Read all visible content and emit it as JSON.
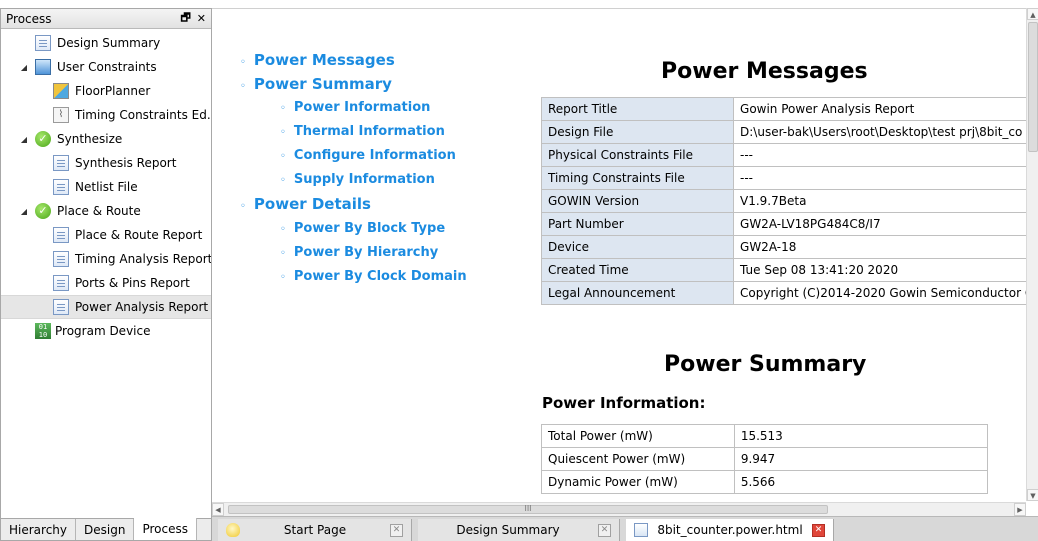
{
  "panel": {
    "title": "Process",
    "float_glyph": "🗗",
    "close_glyph": "✕",
    "tree": [
      {
        "label": "Design Summary",
        "icon": "document-icon"
      },
      {
        "label": "User Constraints",
        "icon": "user-constraints-icon",
        "expander": "◢"
      },
      {
        "label": "FloorPlanner",
        "icon": "floorplanner-icon"
      },
      {
        "label": "Timing Constraints Ed...",
        "icon": "timing-constraints-icon"
      },
      {
        "label": "Synthesize",
        "icon": "check-icon",
        "expander": "◢"
      },
      {
        "label": "Synthesis Report",
        "icon": "document-icon"
      },
      {
        "label": "Netlist File",
        "icon": "document-icon"
      },
      {
        "label": "Place & Route",
        "icon": "check-icon",
        "expander": "◢"
      },
      {
        "label": "Place & Route Report",
        "icon": "document-icon"
      },
      {
        "label": "Timing Analysis Report",
        "icon": "document-icon"
      },
      {
        "label": "Ports & Pins Report",
        "icon": "document-icon"
      },
      {
        "label": "Power Analysis Report",
        "icon": "document-icon",
        "selected": true
      },
      {
        "label": "Program Device",
        "icon": "program-device-icon"
      }
    ],
    "bottom_tabs": [
      "Hierarchy",
      "Design",
      "Process"
    ]
  },
  "toc": {
    "items": [
      {
        "label": "Power Messages",
        "level": 1
      },
      {
        "label": "Power Summary",
        "level": 1
      },
      {
        "label": "Power Information",
        "level": 2
      },
      {
        "label": "Thermal Information",
        "level": 2
      },
      {
        "label": "Configure Information",
        "level": 2
      },
      {
        "label": "Supply Information",
        "level": 2
      },
      {
        "label": "Power Details",
        "level": 1
      },
      {
        "label": "Power By Block Type",
        "level": 2
      },
      {
        "label": "Power By Hierarchy",
        "level": 2
      },
      {
        "label": "Power By Clock Domain",
        "level": 2
      }
    ]
  },
  "report": {
    "messages_heading": "Power Messages",
    "messages_rows": [
      [
        "Report Title",
        "Gowin Power Analysis Report"
      ],
      [
        "Design File",
        "D:\\user-bak\\Users\\root\\Desktop\\test prj\\8bit_co"
      ],
      [
        "Physical Constraints File",
        "---"
      ],
      [
        "Timing Constraints File",
        "---"
      ],
      [
        "GOWIN Version",
        "V1.9.7Beta"
      ],
      [
        "Part Number",
        "GW2A-LV18PG484C8/I7"
      ],
      [
        "Device",
        "GW2A-18"
      ],
      [
        "Created Time",
        "Tue Sep 08 13:41:20 2020"
      ],
      [
        "Legal Announcement",
        "Copyright (C)2014-2020 Gowin Semiconductor C"
      ]
    ],
    "summary_heading": "Power Summary",
    "info_heading": "Power Information:",
    "info_rows": [
      [
        "Total Power (mW)",
        "15.513"
      ],
      [
        "Quiescent Power (mW)",
        "9.947"
      ],
      [
        "Dynamic Power (mW)",
        "5.566"
      ]
    ]
  },
  "scrollbar": {
    "h_thumb_glyph": "III"
  },
  "editor_tabs": [
    {
      "label": "Start Page",
      "icon": "lightbulb-icon",
      "active": false
    },
    {
      "label": "Design Summary",
      "icon": "",
      "active": false
    },
    {
      "label": "8bit_counter.power.html",
      "icon": "html-page-icon",
      "active": true
    }
  ],
  "colors": {
    "link": "#1b8be0",
    "label_cell": "#dde6f1",
    "active_close": "#e0463a"
  }
}
